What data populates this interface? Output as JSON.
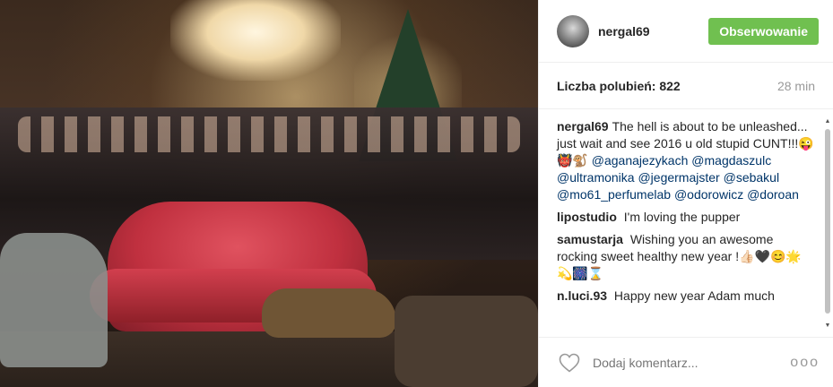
{
  "photo": {
    "alt": ""
  },
  "header": {
    "username": "nergal69",
    "follow_label": "Obserwowanie"
  },
  "meta": {
    "likes": "Liczba polubień: 822",
    "time": "28 min"
  },
  "comments": [
    {
      "author": "nergal69",
      "text": "The hell is about to be unleashed... just wait and see 2016 u old stupid CUNT!!!😜👹🐒",
      "mentions": [
        "@aganajezykach",
        "@magdaszulc",
        "@ultramonika",
        "@jegermajster",
        "@sebakul",
        "@mo61_perfumelab",
        "@odorowicz",
        "@doroan"
      ]
    },
    {
      "author": "lipostudio",
      "text": "I'm loving the pupper"
    },
    {
      "author": "samustarja",
      "text": "Wishing you an awesome rocking sweet healthy new year !👍🏻🖤😊🌟💫🎆⌛"
    },
    {
      "author": "n.luci.93",
      "text": "Happy new year Adam much"
    }
  ],
  "footer": {
    "comment_placeholder": "Dodaj komentarz...",
    "more_label": "ooo"
  },
  "icons": {
    "heart": "heart-icon",
    "more": "more-options-icon",
    "scroll_up": "scroll-up-icon",
    "scroll_down": "scroll-down-icon"
  },
  "colors": {
    "follow_button": "#70c050",
    "mention": "#003569",
    "muted": "#999999"
  }
}
